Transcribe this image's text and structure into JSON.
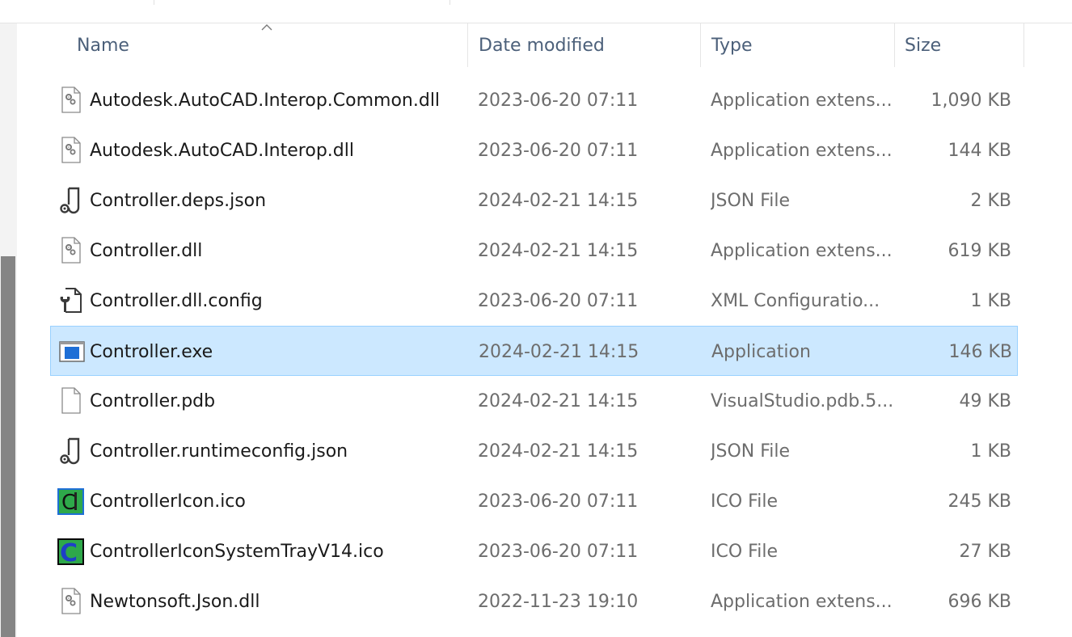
{
  "columns": {
    "name": "Name",
    "date": "Date modified",
    "type": "Type",
    "size": "Size"
  },
  "sort": {
    "column": "name",
    "direction": "ascending",
    "icon": "sort-up-icon"
  },
  "files": [
    {
      "name": "Autodesk.AutoCAD.Interop.Common.dll",
      "date": "2023-06-20 07:11",
      "type": "Application extens...",
      "size": "1,090 KB",
      "icon": "dll-icon",
      "selected": false
    },
    {
      "name": "Autodesk.AutoCAD.Interop.dll",
      "date": "2023-06-20 07:11",
      "type": "Application extens...",
      "size": "144 KB",
      "icon": "dll-icon",
      "selected": false
    },
    {
      "name": "Controller.deps.json",
      "date": "2024-02-21 14:15",
      "type": "JSON File",
      "size": "2 KB",
      "icon": "json-icon",
      "selected": false
    },
    {
      "name": "Controller.dll",
      "date": "2024-02-21 14:15",
      "type": "Application extens...",
      "size": "619 KB",
      "icon": "dll-icon",
      "selected": false
    },
    {
      "name": "Controller.dll.config",
      "date": "2023-06-20 07:11",
      "type": "XML Configuratio...",
      "size": "1 KB",
      "icon": "config-icon",
      "selected": false
    },
    {
      "name": "Controller.exe",
      "date": "2024-02-21 14:15",
      "type": "Application",
      "size": "146 KB",
      "icon": "exe-icon",
      "selected": true
    },
    {
      "name": "Controller.pdb",
      "date": "2024-02-21 14:15",
      "type": "VisualStudio.pdb.5...",
      "size": "49 KB",
      "icon": "blank-file-icon",
      "selected": false
    },
    {
      "name": "Controller.runtimeconfig.json",
      "date": "2024-02-21 14:15",
      "type": "JSON File",
      "size": "1 KB",
      "icon": "json-icon",
      "selected": false
    },
    {
      "name": "ControllerIcon.ico",
      "date": "2023-06-20 07:11",
      "type": "ICO File",
      "size": "245 KB",
      "icon": "controller-ico-icon",
      "selected": false
    },
    {
      "name": "ControllerIconSystemTrayV14.ico",
      "date": "2023-06-20 07:11",
      "type": "ICO File",
      "size": "27 KB",
      "icon": "controller-tray-ico-icon",
      "selected": false
    },
    {
      "name": "Newtonsoft.Json.dll",
      "date": "2022-11-23 19:10",
      "type": "Application extens...",
      "size": "696 KB",
      "icon": "dll-icon",
      "selected": false
    }
  ],
  "colors": {
    "selection_bg": "#cce8ff",
    "selection_border": "#99d1ff",
    "header_text": "#4c607a",
    "ico_green": "#2ea84a",
    "ico_blue": "#1e3fc8"
  }
}
